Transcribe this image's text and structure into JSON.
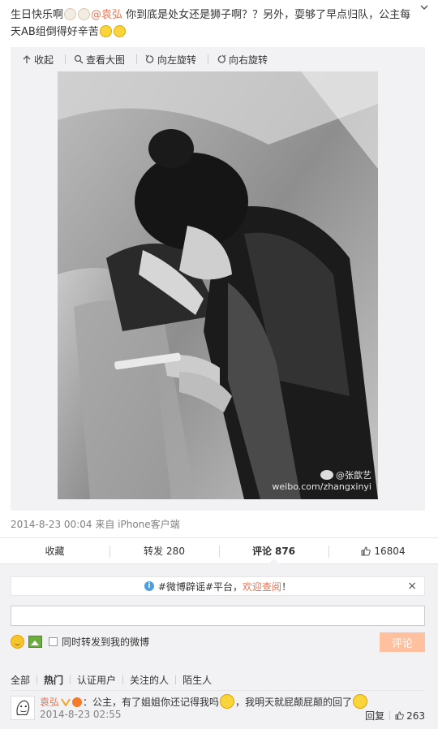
{
  "post": {
    "text_part1": "生日快乐啊",
    "mention": "@袁弘",
    "text_part2": " 你到底是处女还是狮子啊？？另外，耍够了早点归队，公主每天AB组倒得好辛苦",
    "timestamp": "2014-8-23 00:04",
    "source": "来自 iPhone客户端"
  },
  "media_toolbar": {
    "collapse_label": "收起",
    "view_large_label": "查看大图",
    "rotate_left_label": "向左旋转",
    "rotate_right_label": "向右旋转"
  },
  "photo": {
    "watermark_name": "@张歆艺",
    "watermark_url": "weibo.com/zhangxinyi"
  },
  "actions": {
    "favorite_label": "收藏",
    "repost_label": "转发",
    "repost_count": "280",
    "comment_label": "评论",
    "comment_count": "876",
    "like_count": "16804"
  },
  "comment_box": {
    "notice_pre": "#微博辟谣#平台，",
    "notice_link": "欢迎查阅",
    "notice_post": "！",
    "close_glyph": "×",
    "input_value": "",
    "also_forward_label": "同时转发到我的微博",
    "submit_label": "评论"
  },
  "filters": [
    "全部",
    "热门",
    "认证用户",
    "关注的人",
    "陌生人"
  ],
  "active_filter": "热门",
  "comments": [
    {
      "user": "袁弘",
      "text_part1": "：公主，有了姐姐你还记得我吗",
      "text_part2": "，我明天就屁颠屁颠的回了",
      "time": "2014-8-23 02:55",
      "reply_label": "回复",
      "like_count": "263"
    }
  ],
  "colors": {
    "accent": "#eb7350",
    "submit_disabled": "#ffc09f",
    "panel_bg": "#f2f2f5"
  }
}
